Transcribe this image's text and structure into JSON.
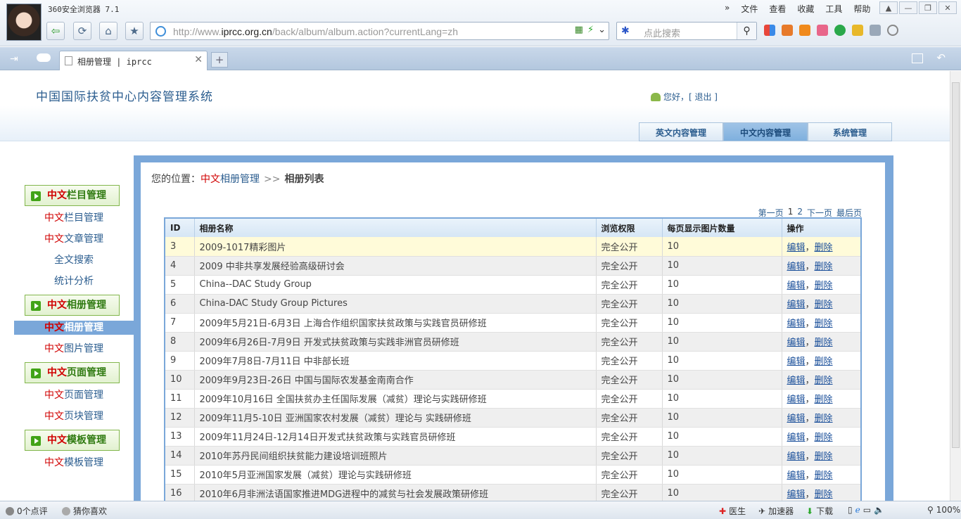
{
  "browser": {
    "app_title": "360安全浏览器 7.1",
    "menu": [
      "文件",
      "查看",
      "收藏",
      "工具",
      "帮助"
    ],
    "url_prefix": "http://www.",
    "url_domain": "iprcc.org.cn",
    "url_path": "/back/album/album.action?currentLang=zh",
    "search_placeholder": "点此搜索",
    "tab_title": "相册管理 | iprcc",
    "newtab": "+"
  },
  "header": {
    "system_title": "中国国际扶贫中心内容管理系统",
    "greeting": "您好，[ 退出 ]",
    "nav_tabs": [
      {
        "label": "英文内容管理"
      },
      {
        "label": "中文内容管理"
      },
      {
        "label": "系统管理"
      }
    ]
  },
  "sidebar": {
    "groups": [
      {
        "prefix": "中文",
        "label": "栏目管理"
      },
      {
        "prefix": "中文",
        "label": "相册管理"
      },
      {
        "prefix": "中文",
        "label": "页面管理"
      },
      {
        "prefix": "中文",
        "label": "模板管理"
      }
    ],
    "items": [
      {
        "prefix": "中文",
        "label": "栏目管理"
      },
      {
        "prefix": "中文",
        "label": "文章管理"
      },
      {
        "prefix": "",
        "label": "全文搜索"
      },
      {
        "prefix": "",
        "label": "统计分析"
      },
      {
        "prefix": "中文",
        "label": "相册管理"
      },
      {
        "prefix": "中文",
        "label": "图片管理"
      },
      {
        "prefix": "中文",
        "label": "页面管理"
      },
      {
        "prefix": "中文",
        "label": "页块管理"
      },
      {
        "prefix": "中文",
        "label": "模板管理"
      }
    ]
  },
  "breadcrumb": {
    "prefix": "您的位置：",
    "lang": "中文",
    "section": "相册管理",
    "sep": ">>",
    "current": "相册列表"
  },
  "pager": {
    "first": "第一页",
    "current": "1",
    "page2": "2",
    "next": "下一页",
    "last": "最后页"
  },
  "table": {
    "headers": [
      "ID",
      "相册名称",
      "浏览权限",
      "每页显示图片数量",
      "操作"
    ],
    "edit_label": "编辑",
    "sep": "，",
    "delete_label": "删除",
    "rows": [
      {
        "id": "3",
        "name": "2009-1017精彩图片",
        "perm": "完全公开",
        "count": "10"
      },
      {
        "id": "4",
        "name": "2009 中非共享发展经验高级研讨会",
        "perm": "完全公开",
        "count": "10"
      },
      {
        "id": "5",
        "name": "China--DAC Study Group",
        "perm": "完全公开",
        "count": "10"
      },
      {
        "id": "6",
        "name": "China-DAC Study Group Pictures",
        "perm": "完全公开",
        "count": "10"
      },
      {
        "id": "7",
        "name": "2009年5月21日-6月3日 上海合作组织国家扶贫政策与实践官员研修班",
        "perm": "完全公开",
        "count": "10"
      },
      {
        "id": "8",
        "name": "2009年6月26日-7月9日 开发式扶贫政策与实践非洲官员研修班",
        "perm": "完全公开",
        "count": "10"
      },
      {
        "id": "9",
        "name": "2009年7月8日-7月11日 中非部长班",
        "perm": "完全公开",
        "count": "10"
      },
      {
        "id": "10",
        "name": "2009年9月23日-26日 中国与国际农发基金南南合作",
        "perm": "完全公开",
        "count": "10"
      },
      {
        "id": "11",
        "name": "2009年10月16日 全国扶贫办主任国际发展（减贫）理论与实践研修班",
        "perm": "完全公开",
        "count": "10"
      },
      {
        "id": "12",
        "name": "2009年11月5-10日 亚洲国家农村发展（减贫）理论与 实践研修班",
        "perm": "完全公开",
        "count": "10"
      },
      {
        "id": "13",
        "name": "2009年11月24日-12月14日开发式扶贫政策与实践官员研修班",
        "perm": "完全公开",
        "count": "10"
      },
      {
        "id": "14",
        "name": "2010年苏丹民间组织扶贫能力建设培训班照片",
        "perm": "完全公开",
        "count": "10"
      },
      {
        "id": "15",
        "name": "2010年5月亚洲国家发展（减贫）理论与实践研修班",
        "perm": "完全公开",
        "count": "10"
      },
      {
        "id": "16",
        "name": "2010年6月非洲法语国家推进MDG进程中的减贫与社会发展政策研修班",
        "perm": "完全公开",
        "count": "10"
      }
    ]
  },
  "statusbar": {
    "comments": "0个点评",
    "guess": "猜你喜欢",
    "doctor": "医生",
    "accelerator": "加速器",
    "download": "下载",
    "zoom": "100%"
  }
}
